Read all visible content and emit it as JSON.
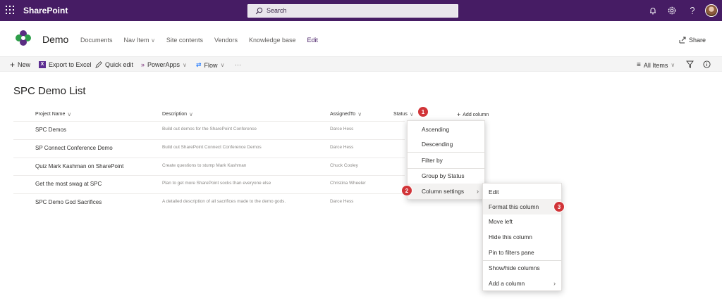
{
  "suite": {
    "brand": "SharePoint",
    "search_placeholder": "Search"
  },
  "site": {
    "title": "Demo",
    "nav": [
      "Documents",
      "Nav Item",
      "Site contents",
      "Vendors",
      "Knowledge base",
      "Edit"
    ],
    "share_label": "Share"
  },
  "toolbar": {
    "new_label": "New",
    "export_label": "Export to Excel",
    "quick_edit_label": "Quick edit",
    "powerapps_label": "PowerApps",
    "flow_label": "Flow",
    "more_label": "···",
    "view_label": "All Items"
  },
  "list": {
    "title": "SPC Demo List",
    "columns": {
      "project_name": "Project Name",
      "description": "Description",
      "assigned_to": "AssignedTo",
      "status": "Status",
      "add_column": "Add column"
    },
    "rows": [
      {
        "name": "SPC Demos",
        "description": "Build out demos for the SharePoint Conference",
        "assigned": "Darce Hess"
      },
      {
        "name": "SP Connect Conference Demo",
        "description": "Build out SharePoint Connect Conference Demos",
        "assigned": "Darce Hess"
      },
      {
        "name": "Quiz Mark Kashman on SharePoint",
        "description": "Create questions to stump Mark Kashman",
        "assigned": "Chuck Cooley"
      },
      {
        "name": "Get the most swag at SPC",
        "description": "Plan to get more SharePoint socks than everyone else",
        "assigned": "Christina Wheeler"
      },
      {
        "name": "SPC Demo God Sacrifices",
        "description": "A detailed description of all sacrifices made to the demo gods.",
        "assigned": "Darce Hess"
      }
    ]
  },
  "status_menu": {
    "items": [
      "Ascending",
      "Descending",
      "Filter by",
      "Group by Status",
      "Column settings"
    ]
  },
  "settings_submenu": {
    "items": [
      "Edit",
      "Format this column",
      "Move left",
      "Hide this column",
      "Pin to filters pane",
      "Show/hide columns",
      "Add a column"
    ]
  },
  "badges": [
    "1",
    "2",
    "3"
  ],
  "colors": {
    "suite_bar": "#461C64",
    "accent": "#461C64",
    "badge": "#d13438"
  }
}
